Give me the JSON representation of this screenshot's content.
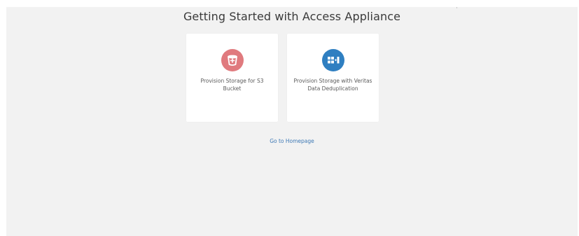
{
  "header": {
    "title": "Getting Started with Access Appliance"
  },
  "cards": [
    {
      "label": "Provision Storage for S3 Bucket",
      "icon": "s3-bucket-icon",
      "color": "#e07a7e"
    },
    {
      "label": "Provision Storage with Veritas Data Deduplication",
      "icon": "deduplication-icon",
      "color": "#2f7fc1"
    }
  ],
  "footer": {
    "home_link": "Go to Homepage"
  },
  "colors": {
    "background": "#f2f2f2",
    "card": "#ffffff",
    "link": "#3e79b5"
  }
}
